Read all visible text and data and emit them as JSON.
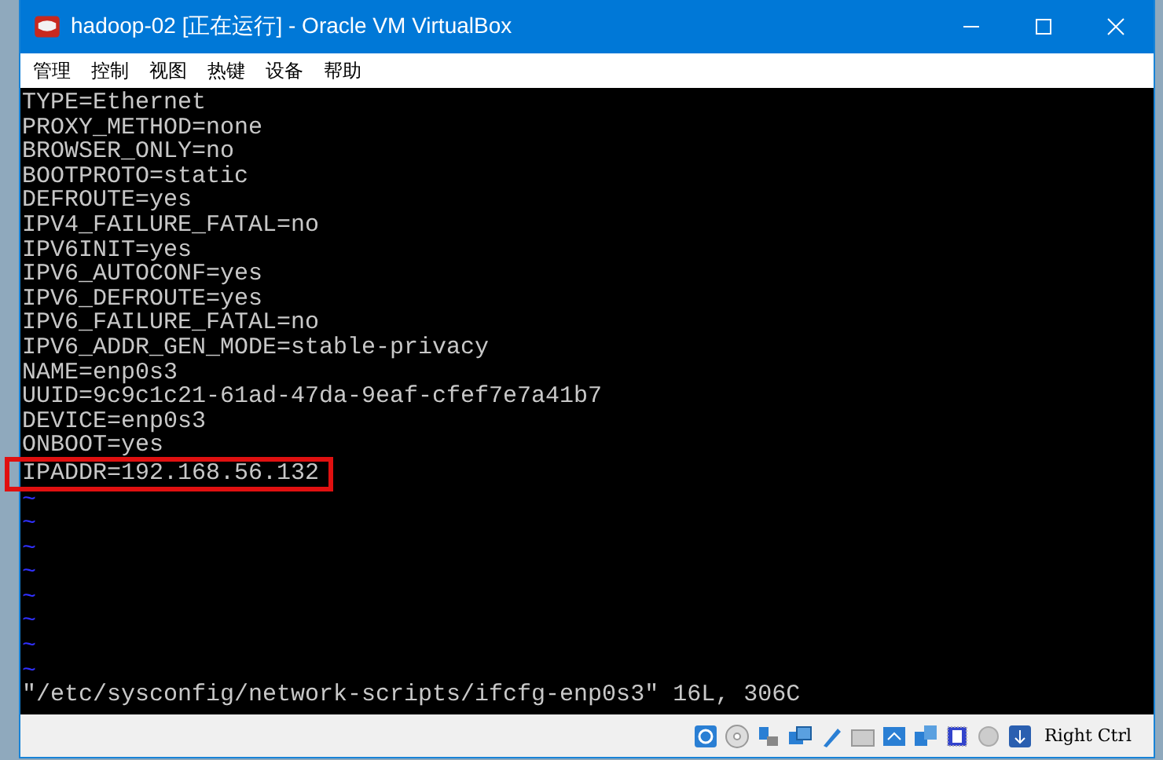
{
  "window": {
    "title": "hadoop-02 [正在运行] - Oracle VM VirtualBox"
  },
  "menu": [
    "管理",
    "控制",
    "视图",
    "热键",
    "设备",
    "帮助"
  ],
  "lines": [
    {
      "text": "TYPE=Ethernet",
      "highlighted": false
    },
    {
      "text": "PROXY_METHOD=none",
      "highlighted": false
    },
    {
      "text": "BROWSER_ONLY=no",
      "highlighted": false
    },
    {
      "text": "BOOTPROTO=static",
      "highlighted": false
    },
    {
      "text": "DEFROUTE=yes",
      "highlighted": false
    },
    {
      "text": "IPV4_FAILURE_FATAL=no",
      "highlighted": false
    },
    {
      "text": "IPV6INIT=yes",
      "highlighted": false
    },
    {
      "text": "IPV6_AUTOCONF=yes",
      "highlighted": false
    },
    {
      "text": "IPV6_DEFROUTE=yes",
      "highlighted": false
    },
    {
      "text": "IPV6_FAILURE_FATAL=no",
      "highlighted": false
    },
    {
      "text": "IPV6_ADDR_GEN_MODE=stable-privacy",
      "highlighted": false
    },
    {
      "text": "NAME=enp0s3",
      "highlighted": false
    },
    {
      "text": "UUID=9c9c1c21-61ad-47da-9eaf-cfef7e7a41b7",
      "highlighted": false
    },
    {
      "text": "DEVICE=enp0s3",
      "highlighted": false
    },
    {
      "text": "ONBOOT=yes",
      "highlighted": false
    },
    {
      "text": "IPADDR=192.168.56.132",
      "highlighted": true
    }
  ],
  "tildes": [
    "~",
    "~",
    "~",
    "~",
    "~",
    "~",
    "~",
    "~"
  ],
  "status_line": "\"/etc/sysconfig/network-scripts/ifcfg-enp0s3\" 16L, 306C",
  "status_bar": {
    "host_key": "Right Ctrl"
  }
}
